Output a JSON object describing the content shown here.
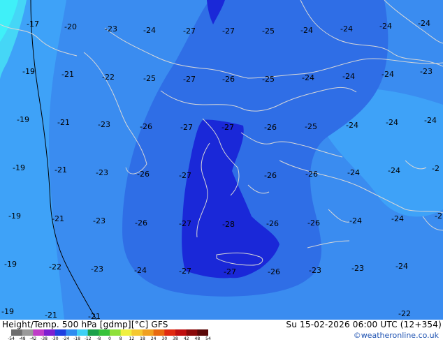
{
  "map": {
    "colors": {
      "ocean_base": "#3a8cf0",
      "band_minus19": "#3ea2f8",
      "band_minus17": "#45d6f6",
      "band_minus15": "#3ff0f8",
      "band_minus25": "#2f6ee6",
      "band_minus27": "#1a28d8",
      "coastline": "#d7d7d7",
      "contour": "#000000"
    },
    "labels": [
      {
        "text": "-17"
      },
      {
        "text": "-20"
      },
      {
        "text": "-23"
      },
      {
        "text": "-24"
      },
      {
        "text": "-27"
      },
      {
        "text": "-27"
      },
      {
        "text": "-25"
      },
      {
        "text": "-24"
      },
      {
        "text": "-24"
      },
      {
        "text": "-24"
      },
      {
        "text": "-24"
      },
      {
        "text": "-19"
      },
      {
        "text": "-21"
      },
      {
        "text": "-22"
      },
      {
        "text": "-25"
      },
      {
        "text": "-27"
      },
      {
        "text": "-26"
      },
      {
        "text": "-25"
      },
      {
        "text": "-24"
      },
      {
        "text": "-24"
      },
      {
        "text": "-24"
      },
      {
        "text": "-23"
      },
      {
        "text": "-19"
      },
      {
        "text": "-21"
      },
      {
        "text": "-23"
      },
      {
        "text": "-26"
      },
      {
        "text": "-27"
      },
      {
        "text": "-27"
      },
      {
        "text": "-26"
      },
      {
        "text": "-25"
      },
      {
        "text": "-24"
      },
      {
        "text": "-24"
      },
      {
        "text": "-24"
      },
      {
        "text": "-19"
      },
      {
        "text": "-21"
      },
      {
        "text": "-23"
      },
      {
        "text": "-26"
      },
      {
        "text": "-27"
      },
      {
        "text": "-26"
      },
      {
        "text": "-26"
      },
      {
        "text": "-24"
      },
      {
        "text": "-24"
      },
      {
        "text": "-2"
      },
      {
        "text": "-19"
      },
      {
        "text": "-21"
      },
      {
        "text": "-23"
      },
      {
        "text": "-26"
      },
      {
        "text": "-27"
      },
      {
        "text": "-28"
      },
      {
        "text": "-26"
      },
      {
        "text": "-26"
      },
      {
        "text": "-24"
      },
      {
        "text": "-24"
      },
      {
        "text": "-2"
      },
      {
        "text": "-19"
      },
      {
        "text": "-22"
      },
      {
        "text": "-23"
      },
      {
        "text": "-24"
      },
      {
        "text": "-27"
      },
      {
        "text": "-27"
      },
      {
        "text": "-26"
      },
      {
        "text": "-23"
      },
      {
        "text": "-23"
      },
      {
        "text": "-24"
      },
      {
        "text": "-19"
      },
      {
        "text": "-21"
      },
      {
        "text": "-21"
      },
      {
        "text": "-22"
      }
    ]
  },
  "footer": {
    "title": "Height/Temp. 500 hPa [gdmp][°C] GFS",
    "valid_time": "Su 15-02-2026 06:00 UTC (12+354)",
    "credit": "©weatheronline.co.uk",
    "scale_ticks": [
      "-54",
      "-48",
      "-42",
      "-38",
      "-30",
      "-24",
      "-18",
      "-12",
      "-8",
      "0",
      "8",
      "12",
      "18",
      "24",
      "30",
      "38",
      "42",
      "48",
      "54"
    ],
    "scale_colors": [
      "#6e6e6e",
      "#9a9a9a",
      "#c03cc8",
      "#7d1fd0",
      "#1f3ee0",
      "#2f8cf0",
      "#3fd0f5",
      "#1aa04a",
      "#37c23a",
      "#8fe03a",
      "#f0f040",
      "#f5c830",
      "#f0a020",
      "#e86a10",
      "#e02a10",
      "#c01010",
      "#8a0a0a",
      "#5a0808"
    ]
  }
}
